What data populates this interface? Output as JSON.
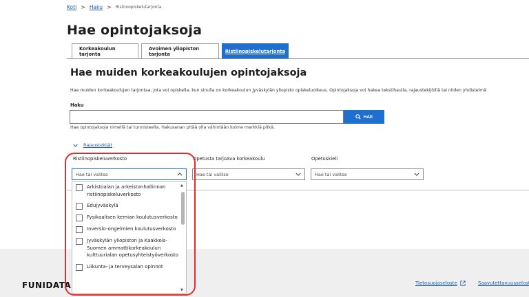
{
  "breadcrumb": {
    "home": "Koti",
    "search": "Haku",
    "current": "Ristiinopiskelutarjonta",
    "separator": ">"
  },
  "page_title": "Hae opintojaksoja",
  "tabs": [
    {
      "label": "Korkeakoulun tarjonta",
      "active": false
    },
    {
      "label": "Avoimen yliopiston tarjonta",
      "active": false
    },
    {
      "label": "Ristiinopiskelutarjonta",
      "active": true
    }
  ],
  "section": {
    "title": "Hae muiden korkeakoulujen opintojaksoja",
    "intro": "Hae muiden korkeakoulujen tarjontaa, jota voi opiskella, kun sinulla on korkeakoulun Jyväskylän yliopisto opiskeluoikeus. Opintojaksoja voi hakea tekstihaulla, rajaustekijöillä tai niiden yhdistelmä"
  },
  "search": {
    "label": "Haku",
    "value": "",
    "button_label": "HAE",
    "help": "Hae opintojaksoja nimellä tai tunnisteella. Hakusanan pitää olla vähintään kolme merkkiä pitkä."
  },
  "filters": {
    "toggle_label": "Rajaustekijät",
    "network": {
      "label": "Ristiinopiskeluverkosto",
      "placeholder": "Hae tai valitse"
    },
    "school": {
      "label": "Opetusta tarjoava korkeakoulu",
      "placeholder": "Hae tai valitse"
    },
    "language": {
      "label": "Opetuskieli",
      "placeholder": "Hae tai valitse"
    }
  },
  "dropdown_options": [
    "Arkistoalan ja arkeistonhallinnan ristiinopiskeluverkosto",
    "Edujyväskylä",
    "Fysikaalisen kemian koulutusverkosto",
    "Inversio-ongelmien koulutusverkosto",
    "Jyväskylän yliopiston ja Kaakkois-Suomen ammattikorkeakoulun kulttuurialan opetusyhteistyöverkosto",
    "Liikunta- ja terveysalan opinnot"
  ],
  "footer": {
    "logo": "FUNIDATA",
    "privacy": "Tietosuojaseloste",
    "accessibility": "Saavutettavuusseloste"
  },
  "colors": {
    "accent": "#1f6fd1",
    "highlight": "#e22b2b",
    "footer_bg": "#efefef"
  }
}
